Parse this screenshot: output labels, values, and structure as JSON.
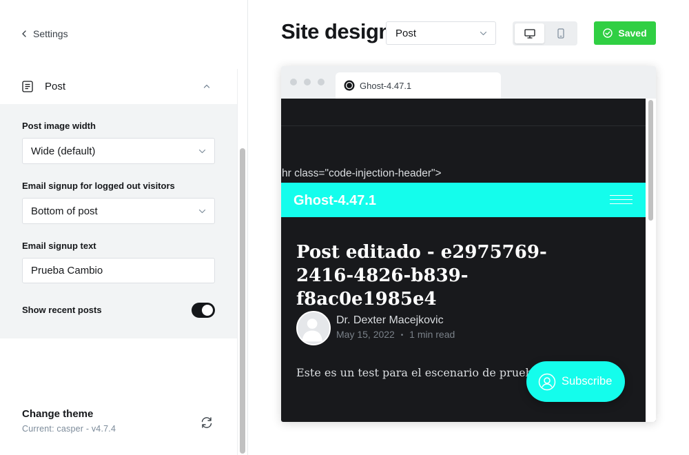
{
  "sidebar": {
    "back_label": "Settings",
    "section": {
      "title": "Post"
    },
    "fields": {
      "image_width_label": "Post image width",
      "image_width_value": "Wide (default)",
      "email_signup_label": "Email signup for logged out visitors",
      "email_signup_value": "Bottom of post",
      "email_text_label": "Email signup text",
      "email_text_value": "Prueba Cambio",
      "recent_posts_label": "Show recent posts",
      "recent_posts_enabled": true
    },
    "theme": {
      "title": "Change theme",
      "subtitle": "Current: casper - v4.7.4"
    }
  },
  "main": {
    "title": "Site design",
    "page_select": "Post",
    "device": "desktop",
    "saved_label": "Saved",
    "accent_color": "#30cf43"
  },
  "preview": {
    "tab_title": "Ghost-4.47.1",
    "code_leak": "hr class=\"code-injection-header\">",
    "site_name": "Ghost-4.47.1",
    "brand_color": "#14fdec",
    "post_title": "Post editado - e2975769-2416-4826-b839-f8ac0e1985e4",
    "author": "Dr. Dexter Macejkovic",
    "date": "May 15, 2022",
    "separator": "•",
    "read_time": "1 min read",
    "excerpt": "Este es un test para el escenario de prueba 3",
    "subscribe_label": "Subscribe"
  }
}
